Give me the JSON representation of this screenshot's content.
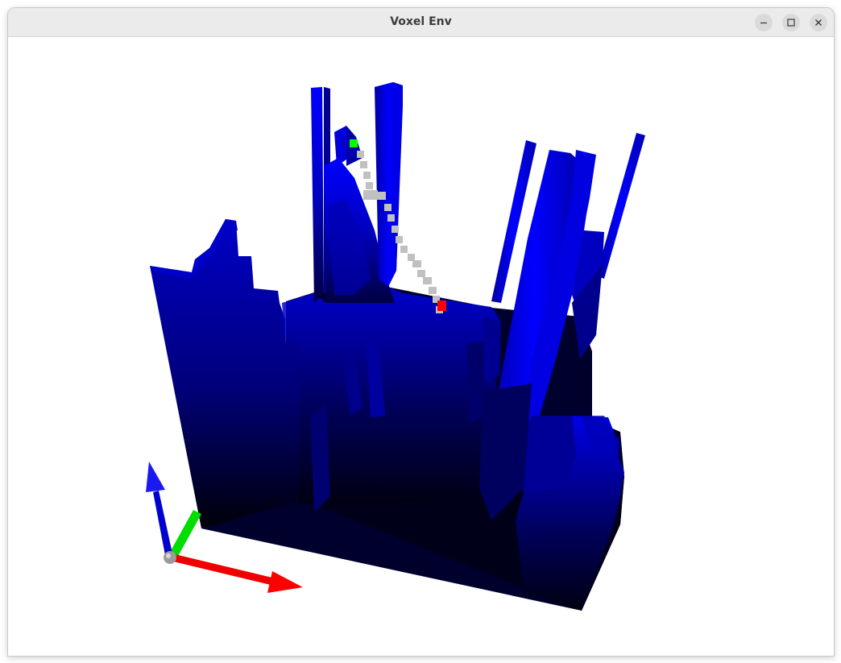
{
  "window": {
    "title": "Voxel Env",
    "controls": {
      "minimize": "minimize-icon",
      "maximize": "maximize-icon",
      "close": "close-icon"
    }
  },
  "scene": {
    "voxel_color": "#0000ff",
    "path_color": "#c0c0c0",
    "start_marker_color": "#00ff00",
    "goal_marker_color": "#ff0000",
    "axes": {
      "x_color": "#ff0000",
      "y_color": "#00ff00",
      "z_color": "#0000ff"
    }
  }
}
